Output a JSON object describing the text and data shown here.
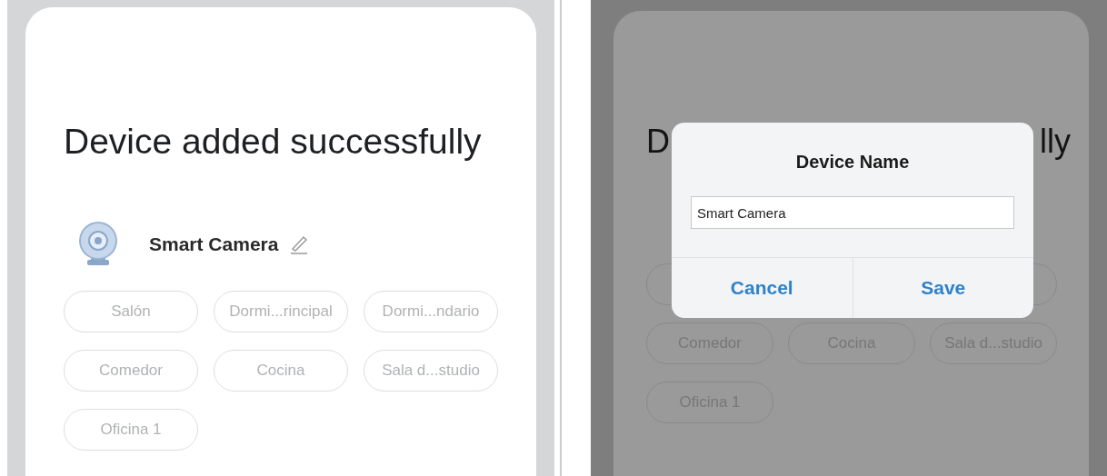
{
  "left_screen": {
    "title": "Device added successfully",
    "device": {
      "name": "Smart Camera"
    },
    "rooms": [
      {
        "label": "Salón"
      },
      {
        "label": "Dormi...rincipal"
      },
      {
        "label": "Dormi...ndario"
      },
      {
        "label": "Comedor"
      },
      {
        "label": "Cocina"
      },
      {
        "label": "Sala d...studio"
      },
      {
        "label": "Oficina 1"
      }
    ]
  },
  "right_screen": {
    "title_start": "D",
    "title_end": "lly",
    "rooms": [
      {
        "label": "Comedor"
      },
      {
        "label": "Cocina"
      },
      {
        "label": "Sala d...studio"
      },
      {
        "label": "Oficina 1"
      }
    ],
    "dialog": {
      "title": "Device Name",
      "input_value": "Smart Camera",
      "buttons": [
        "Cancel",
        "Save"
      ]
    }
  }
}
